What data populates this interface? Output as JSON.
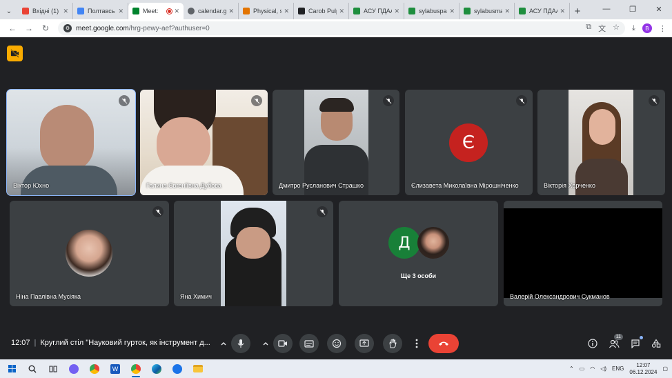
{
  "browser": {
    "tabs": [
      {
        "label": "Вхідні (1)",
        "color": "#ea4335",
        "active": false
      },
      {
        "label": "Полтавсь",
        "color": "#4285f4",
        "active": false
      },
      {
        "label": "Meet:",
        "color": "#00832d",
        "active": true
      },
      {
        "label": "calendar.g",
        "color": "#5f6368",
        "active": false
      },
      {
        "label": "Physical, s",
        "color": "#e37400",
        "active": false
      },
      {
        "label": "Carob Pulp",
        "color": "#202124",
        "active": false
      },
      {
        "label": "АСУ ПДАА",
        "color": "#1e8e3e",
        "active": false
      },
      {
        "label": "sylabuspa",
        "color": "#1e8e3e",
        "active": false
      },
      {
        "label": "sylabusma",
        "color": "#1e8e3e",
        "active": false
      },
      {
        "label": "АСУ ПДАА",
        "color": "#1e8e3e",
        "active": false
      }
    ],
    "url_host": "meet.google.com",
    "url_path": "/hrg-pewy-aef?authuser=0",
    "profile_initial": "B"
  },
  "meeting": {
    "participants": [
      {
        "name": "Віктор Юхно",
        "muted": true,
        "speaking": true
      },
      {
        "name": "Галина Євгеніївна Дубова",
        "muted": true
      },
      {
        "name": "Дмитро Русланович Страшко",
        "muted": true
      },
      {
        "name": "Єлизавета Миколаївна Мірошніченко",
        "muted": true,
        "avatar_letter": "Є",
        "avatar_color": "#c5221f"
      },
      {
        "name": "Вікторія Харченко",
        "muted": true
      },
      {
        "name": "Ніна Павлівна Мусіяка",
        "muted": true
      },
      {
        "name": "Яна Химич",
        "muted": true
      },
      {
        "name": "Валерій Олександрович Сукманов",
        "muted": false
      }
    ],
    "more": {
      "label": "Ще 3 особи",
      "avatar_letter": "Д",
      "avatar_color": "#188038"
    },
    "time": "12:07",
    "title": "Круглий стіл \"Науковий гурток, як інструмент д...",
    "people_count": "11"
  },
  "taskbar": {
    "language": "ENG",
    "time": "12:07",
    "date": "06.12.2024"
  },
  "colors": {
    "end_call": "#ea4335",
    "accent": "#8ab4f8",
    "cam_off": "#f9ab00"
  }
}
